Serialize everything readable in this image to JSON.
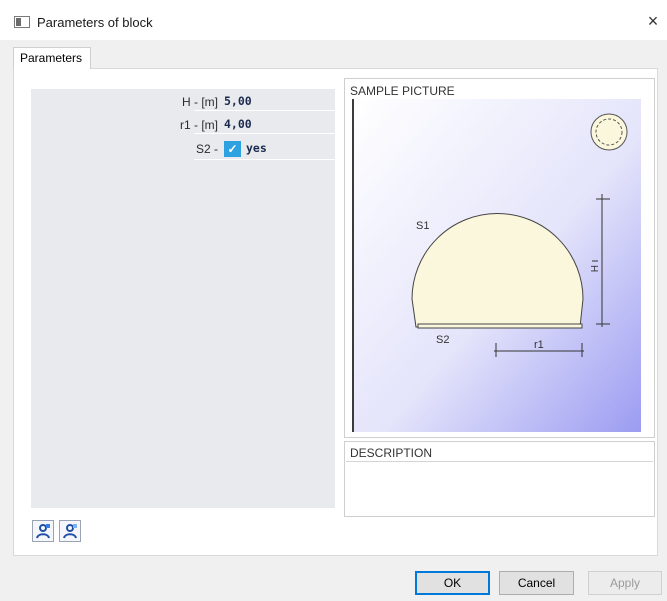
{
  "window": {
    "title": "Parameters of block",
    "close_glyph": "×",
    "icon": "window-icon"
  },
  "tabs": [
    {
      "label": "Parameters",
      "selected": true
    }
  ],
  "parameters": {
    "rows": [
      {
        "label": "H - [m]",
        "value": "5,00"
      },
      {
        "label": "r1 - [m]",
        "value": "4,00"
      },
      {
        "label": "S2 -",
        "value": "yes",
        "checked": true
      }
    ]
  },
  "tool_buttons": [
    {
      "icon": "user-add-icon"
    },
    {
      "icon": "user-remove-icon"
    }
  ],
  "sample_picture": {
    "title": "SAMPLE PICTURE",
    "labels": {
      "s1": "S1",
      "s2": "S2",
      "h": "H",
      "r1": "r1"
    },
    "colors": {
      "gradient_start": "#ffffff",
      "gradient_end": "#9b9bf2",
      "fill": "#fbf7dc"
    }
  },
  "description": {
    "title": "DESCRIPTION",
    "text": ""
  },
  "buttons": {
    "ok": "OK",
    "cancel": "Cancel",
    "apply": "Apply"
  }
}
